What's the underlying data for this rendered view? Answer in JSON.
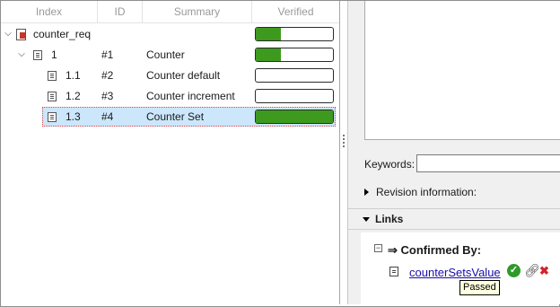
{
  "columns": {
    "index": "Index",
    "id": "ID",
    "summary": "Summary",
    "verified": "Verified"
  },
  "tree": {
    "root": {
      "label": "counter_req",
      "verified": 0.33
    },
    "rows": [
      {
        "index": "1",
        "id": "#1",
        "summary": "Counter",
        "verified": 0.33,
        "selected": false
      },
      {
        "index": "1.1",
        "id": "#2",
        "summary": "Counter default",
        "verified": 0.0,
        "selected": false
      },
      {
        "index": "1.2",
        "id": "#3",
        "summary": "Counter increment",
        "verified": 0.0,
        "selected": false
      },
      {
        "index": "1.3",
        "id": "#4",
        "summary": "Counter Set",
        "verified": 1.0,
        "selected": true
      }
    ]
  },
  "detail": {
    "keywords_label": "Keywords:",
    "keywords_value": "",
    "revision_label": "Revision information:",
    "links_header": "Links",
    "confirmed_by": "⇒ Confirmed By:",
    "link_text": "counterSetsValue",
    "tooltip": "Passed"
  },
  "colors": {
    "verified_fill": "#3e9a1f",
    "selection": "#cce6fb",
    "link": "#1a0dab",
    "check": "#2e9a2a",
    "delete": "#d2232a"
  }
}
